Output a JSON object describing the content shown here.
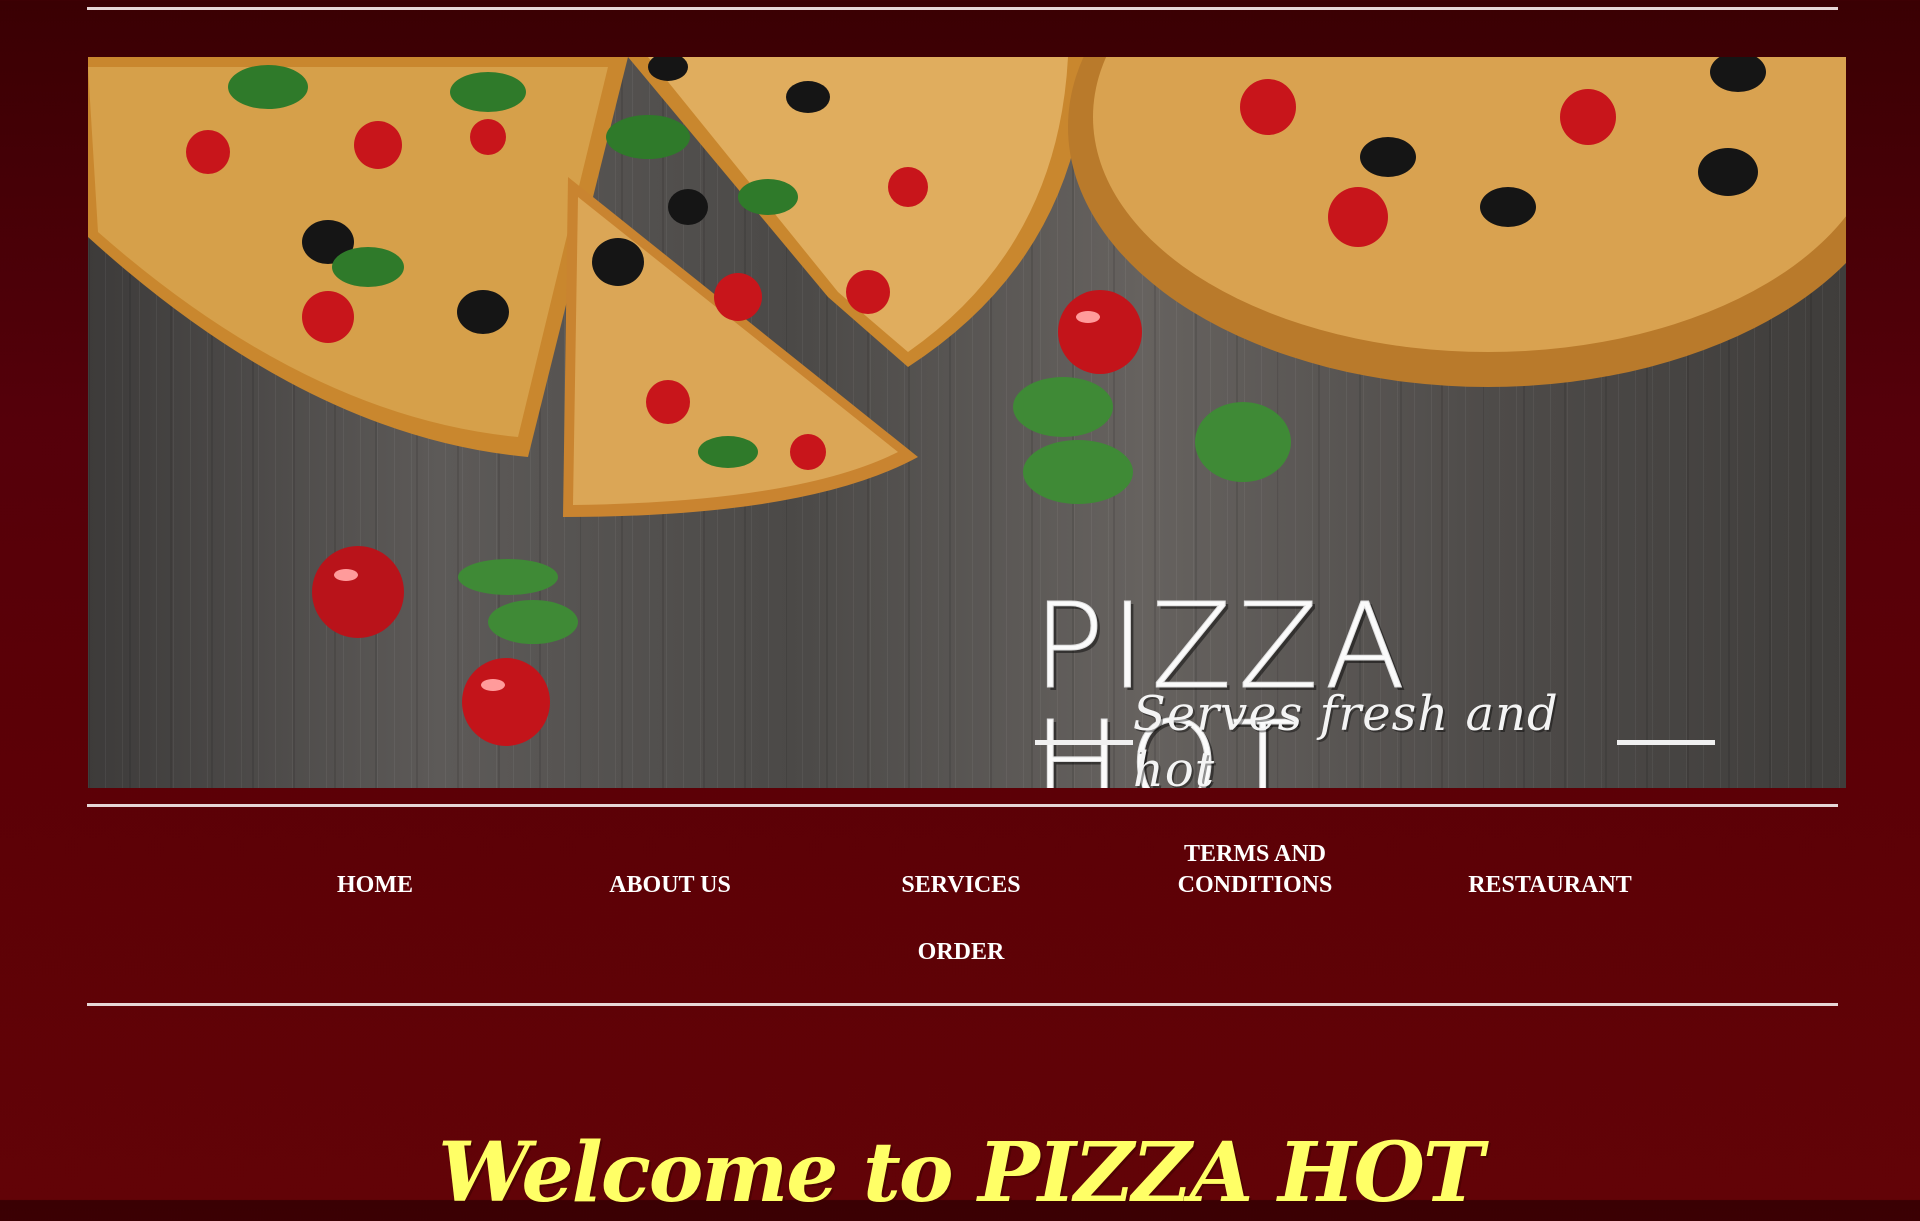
{
  "banner": {
    "brand_title": "PIZZA HOT",
    "brand_tagline": "Serves fresh and hot"
  },
  "nav": {
    "items": [
      {
        "label": "HOME"
      },
      {
        "label": "ABOUT US"
      },
      {
        "label": "SERVICES"
      },
      {
        "label": "TERMS AND CONDITIONS"
      },
      {
        "label": "RESTAURANT"
      },
      {
        "label": "ORDER"
      }
    ]
  },
  "welcome": {
    "heading": "Welcome to PIZZA HOT"
  },
  "colors": {
    "background": "#5b0006",
    "rule": "#e6d6d6",
    "nav_text": "#ffffff",
    "heading": "#ffff66"
  }
}
